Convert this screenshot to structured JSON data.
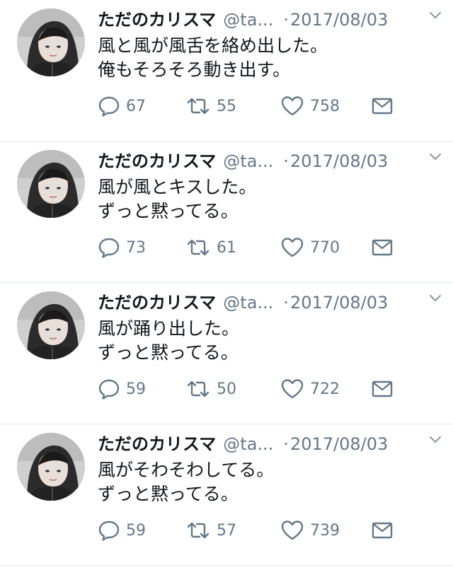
{
  "colors": {
    "text": "#14171a",
    "muted": "#657786",
    "divider": "#e1e8ed"
  },
  "icons": {
    "reply": "reply-icon",
    "retweet": "retweet-icon",
    "like": "heart-icon",
    "dm": "envelope-icon",
    "caret": "chevron-down-icon",
    "avatar": "user-avatar"
  },
  "tweets": [
    {
      "name": "ただのカリスマ",
      "handle": "@ta...",
      "separator": "·",
      "date": "2017/08/03",
      "lines": [
        "風と風が風舌を絡め出した。",
        "俺もそろそろ動き出す。"
      ],
      "replies": "67",
      "retweets": "55",
      "likes": "758"
    },
    {
      "name": "ただのカリスマ",
      "handle": "@ta...",
      "separator": "·",
      "date": "2017/08/03",
      "lines": [
        "風が風とキスした。",
        "ずっと黙ってる。"
      ],
      "replies": "73",
      "retweets": "61",
      "likes": "770"
    },
    {
      "name": "ただのカリスマ",
      "handle": "@ta...",
      "separator": "·",
      "date": "2017/08/03",
      "lines": [
        "風が踊り出した。",
        "ずっと黙ってる。"
      ],
      "replies": "59",
      "retweets": "50",
      "likes": "722"
    },
    {
      "name": "ただのカリスマ",
      "handle": "@ta...",
      "separator": "·",
      "date": "2017/08/03",
      "lines": [
        "風がそわそわしてる。",
        "ずっと黙ってる。"
      ],
      "replies": "59",
      "retweets": "57",
      "likes": "739"
    }
  ]
}
